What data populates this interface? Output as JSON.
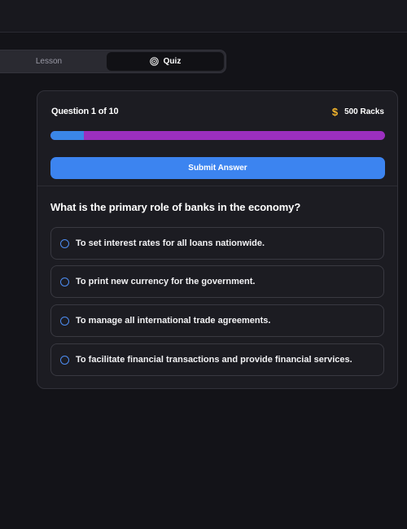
{
  "tabs": {
    "lesson_label": "Lesson",
    "quiz_label": "Quiz",
    "quiz_icon": "target-icon"
  },
  "quiz": {
    "question_counter": "Question 1 of 10",
    "racks_icon": "dollar-icon",
    "racks_symbol": "$",
    "racks_label": "500 Racks",
    "progress_fraction": 0.1,
    "submit_label": "Submit Answer",
    "question": "What is the primary role of banks in the economy?",
    "options": [
      "To set interest rates for all loans nationwide.",
      "To print new currency for the government.",
      "To manage all international trade agreements.",
      "To facilitate financial transactions and provide financial services."
    ]
  },
  "colors": {
    "background": "#131318",
    "card": "#1c1c22",
    "accent_blue": "#3c84f0",
    "progress_purple": "#9b2fbf",
    "coin_gold": "#f3b52c"
  }
}
